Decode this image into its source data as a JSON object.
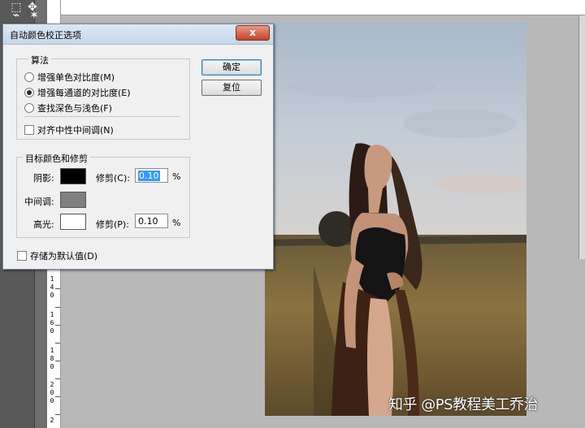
{
  "dialog": {
    "title": "自动颜色校正选项",
    "close_symbol": "x",
    "algorithm": {
      "legend": "算法",
      "options": [
        {
          "label": "增强单色对比度(M)",
          "selected": false
        },
        {
          "label": "增强每通道的对比度(E)",
          "selected": true
        },
        {
          "label": "查找深色与浅色(F)",
          "selected": false
        }
      ],
      "snap_neutral_label": "对齐中性中间调(N)",
      "snap_neutral_checked": false
    },
    "buttons": {
      "ok": "确定",
      "reset": "复位"
    },
    "target": {
      "legend": "目标颜色和修剪",
      "shadows_label": "阴影:",
      "shadows_color": "#000000",
      "shadows_clip_label": "修剪(C):",
      "shadows_clip_value": "0.10",
      "midtones_label": "中间调:",
      "midtones_color": "#808080",
      "highlights_label": "高光:",
      "highlights_color": "#ffffff",
      "highlights_clip_label": "修剪(P):",
      "highlights_clip_value": "0.10",
      "percent": "%"
    },
    "save_default_label": "存储为默认值(D)",
    "save_default_checked": false
  },
  "ruler": {
    "left_numbers": [
      "1",
      "4",
      "0",
      "1",
      "6",
      "0",
      "1",
      "8",
      "0",
      "2",
      "0",
      "0",
      "2"
    ]
  },
  "watermark": "知乎 @PS教程美工乔治",
  "icons": {
    "tool1": "marquee-icon",
    "tool2": "magic-wand-icon",
    "tool3": "lasso-icon",
    "tool4": "quick-select-icon",
    "close": "close-icon"
  }
}
